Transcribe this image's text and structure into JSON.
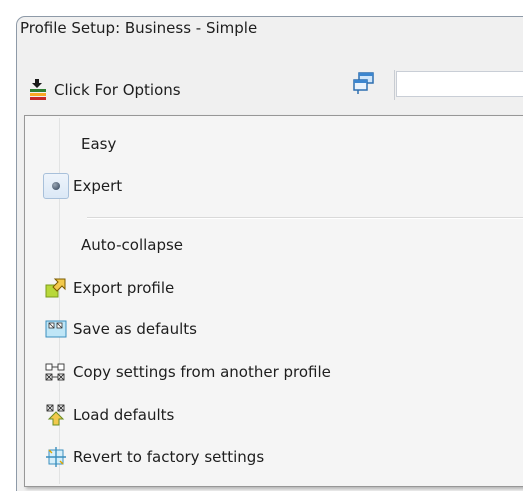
{
  "window": {
    "title": "Profile Setup: Business - Simple"
  },
  "toolbar": {
    "options_label": "Click For Options",
    "options_icon": "options-icon",
    "side_icon": "windows-icon",
    "search_value": ""
  },
  "menu": {
    "items": [
      {
        "label": "Easy",
        "icon": null,
        "checked": false
      },
      {
        "label": "Expert",
        "icon": "radio-dot",
        "checked": true
      },
      {
        "label": "Auto-collapse",
        "icon": null,
        "checked": false
      },
      {
        "label": "Export profile",
        "icon": "export-icon"
      },
      {
        "label": "Save as defaults",
        "icon": "save-defaults-icon"
      },
      {
        "label": "Copy settings from another profile",
        "icon": "copy-settings-icon"
      },
      {
        "label": "Load defaults",
        "icon": "load-defaults-icon"
      },
      {
        "label": "Revert to factory settings",
        "icon": "revert-icon"
      }
    ]
  },
  "colors": {
    "window_bg": "#f0f0f0",
    "menu_bg": "#f5f5f5",
    "radio_highlight": "#dbe8f6"
  }
}
